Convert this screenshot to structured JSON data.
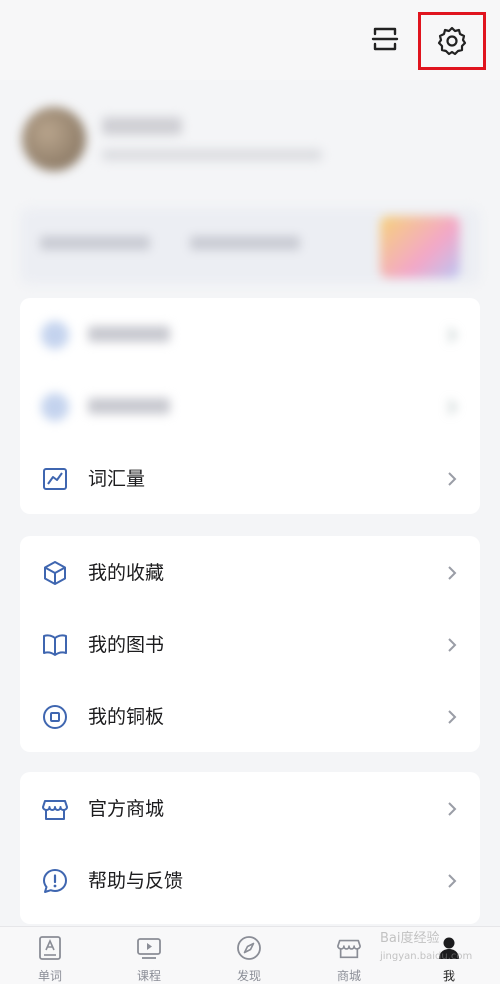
{
  "header": {
    "scan_icon": "scan-icon",
    "settings_icon": "gear-icon"
  },
  "profile": {
    "avatar": "avatar-blurred",
    "name": "",
    "subtitle": ""
  },
  "card_vocab": {
    "items": [
      {
        "icon": "blurred-icon",
        "label": ""
      },
      {
        "icon": "blurred-icon",
        "label": ""
      },
      {
        "icon": "chart-icon",
        "label": "词汇量"
      }
    ]
  },
  "card_collection": {
    "items": [
      {
        "icon": "cube-icon",
        "label": "我的收藏"
      },
      {
        "icon": "book-icon",
        "label": "我的图书"
      },
      {
        "icon": "coin-icon",
        "label": "我的铜板"
      }
    ]
  },
  "card_service": {
    "items": [
      {
        "icon": "store-icon",
        "label": "官方商城"
      },
      {
        "icon": "feedback-icon",
        "label": "帮助与反馈"
      }
    ]
  },
  "tabbar": {
    "tabs": [
      {
        "icon": "word-icon",
        "label": "单词"
      },
      {
        "icon": "course-icon",
        "label": "课程"
      },
      {
        "icon": "compass-icon",
        "label": "发现"
      },
      {
        "icon": "store-icon",
        "label": "商城"
      },
      {
        "icon": "profile-icon",
        "label": "我",
        "active": true
      }
    ]
  },
  "watermark": {
    "line1": "Bai度经验",
    "line2": "jingyan.baidu.com"
  }
}
